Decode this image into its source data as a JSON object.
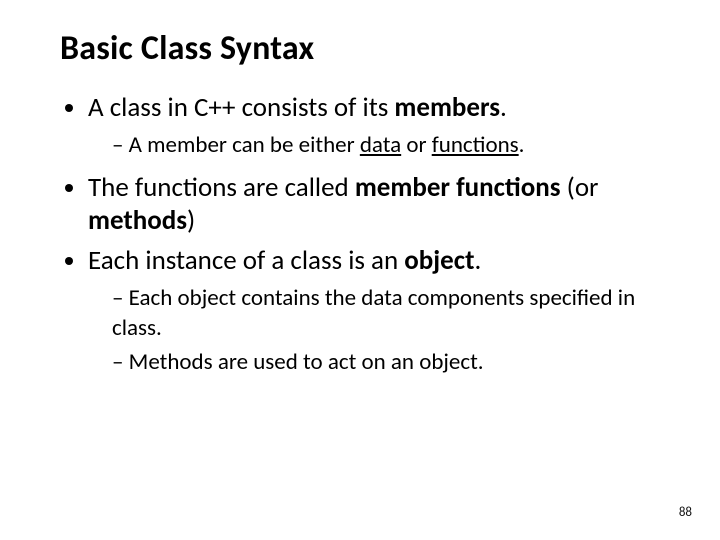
{
  "title": "Basic Class Syntax",
  "b1a": "A class in C++ consists of its ",
  "b1b": "members",
  "b1c": ".",
  "s1a": "A member can be either ",
  "s1b": "data",
  "s1c": " or ",
  "s1d": "functions",
  "s1e": ".",
  "b2a": "The functions are called ",
  "b2b": "member functions",
  "b2c": " (or ",
  "b2d": "methods",
  "b2e": ")",
  "b3a": "Each instance of a class is an ",
  "b3b": "object",
  "b3c": ".",
  "s2": "Each object contains the data components specified in class.",
  "s3": "Methods are used to act on an object.",
  "page": "88"
}
